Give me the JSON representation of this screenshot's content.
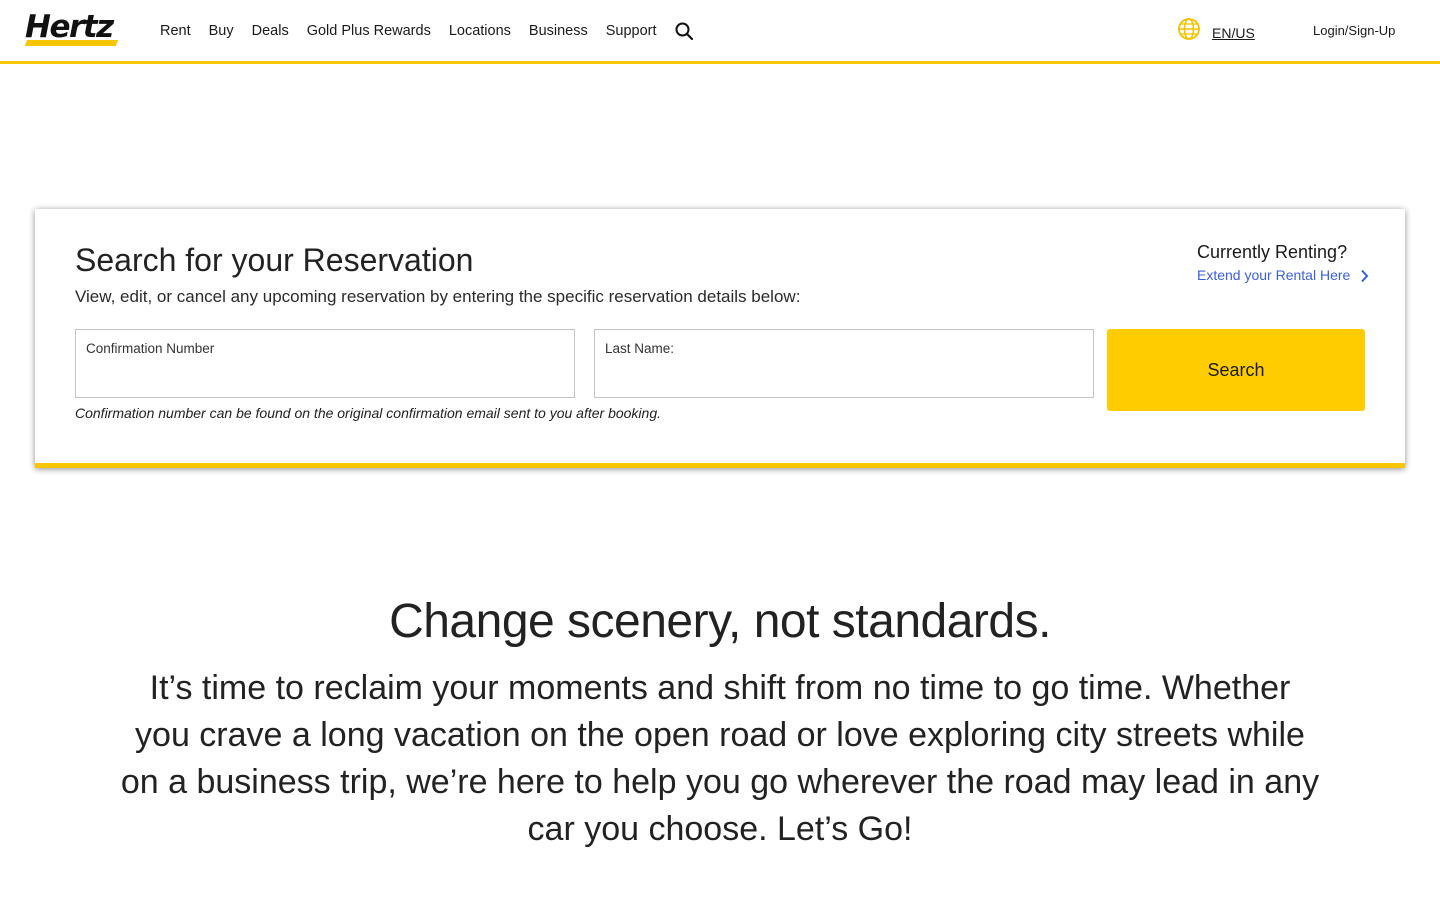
{
  "brand": {
    "logo_text": "Hertz",
    "accent_color": "#f7c600",
    "button_color": "#ffcc00",
    "link_color": "#3b5fd9"
  },
  "nav": {
    "items": [
      {
        "label": "Rent"
      },
      {
        "label": "Buy"
      },
      {
        "label": "Deals"
      },
      {
        "label": "Gold Plus Rewards"
      },
      {
        "label": "Locations"
      },
      {
        "label": "Business"
      },
      {
        "label": "Support"
      }
    ],
    "search_icon": "search-icon",
    "language": "EN/US",
    "language_icon": "globe-icon",
    "login": "Login/Sign-Up"
  },
  "reservation": {
    "title": "Search for your Reservation",
    "subtitle": "View, edit, or cancel any upcoming reservation by entering the specific reservation details below:",
    "renting_title": "Currently Renting?",
    "extend_link": "Extend your Rental Here",
    "fields": {
      "confirmation_label": "Confirmation Number",
      "confirmation_value": "",
      "last_name_label": "Last Name:",
      "last_name_value": ""
    },
    "helper_text": "Confirmation number can be found on the original confirmation email sent to you after booking.",
    "search_button": "Search"
  },
  "promo": {
    "headline": "Change scenery, not standards.",
    "body": "It’s time to reclaim your moments and shift from no time to go time. Whether you crave a long vacation on the open road or love exploring city streets while on a business trip, we’re here to help you go wherever the road may lead in any car you choose. Let’s Go!"
  }
}
